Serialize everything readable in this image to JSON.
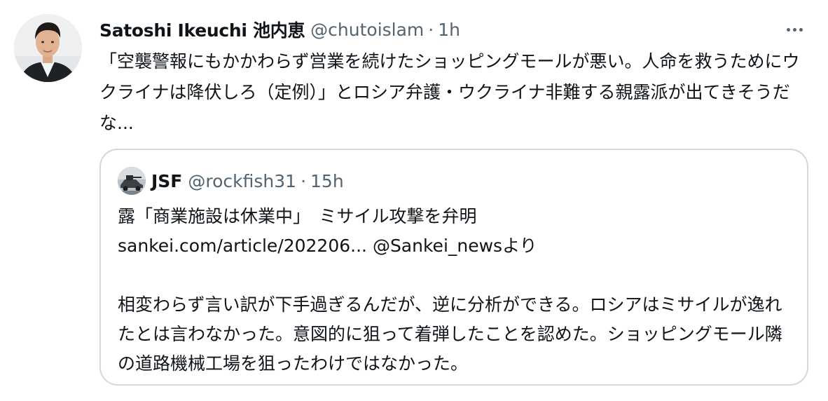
{
  "author": {
    "display_name": "Satoshi Ikeuchi 池内恵",
    "handle": "@chutoislam",
    "separator": "·",
    "time": "1h",
    "avatar_icon": "person-photo-avatar"
  },
  "tweet": {
    "text": "「空襲警報にもかかわらず営業を続けたショッピングモールが悪い。人命を救うためにウクライナは降伏しろ（定例）」とロシア弁護・ウクライナ非難する親露派が出てきそうだな..."
  },
  "more_icon": "more-horizontal-icon",
  "quote": {
    "display_name": "JSF",
    "handle": "@rockfish31",
    "separator": "·",
    "time": "15h",
    "avatar_icon": "vehicle-photo-avatar",
    "line1": "露「商業施設は休業中」　ミサイル攻撃を弁明",
    "link_text": "sankei.com/article/202206...",
    "mention": "@Sankei_news",
    "mention_suffix": "より",
    "body": "相変わらず言い訳が下手過ぎるんだが、逆に分析ができる。ロシアはミサイルが逸れたとは言わなかった。意図的に狙って着弾したことを認めた。ショッピングモール隣の道路機械工場を狙ったわけではなかった。"
  },
  "colors": {
    "text_primary": "#0f1419",
    "text_secondary": "#536471",
    "border": "#cfd9de",
    "background": "#ffffff"
  }
}
